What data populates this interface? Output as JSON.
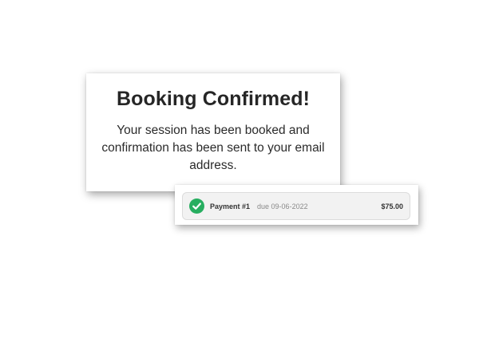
{
  "confirmation": {
    "title": "Booking Confirmed!",
    "message": "Your session has been booked and confirmation has been sent to your email address."
  },
  "payment": {
    "status_icon": "check-circle-icon",
    "status_color": "#27ae60",
    "label": "Payment #1",
    "due": "due 09-06-2022",
    "amount": "$75.00"
  }
}
